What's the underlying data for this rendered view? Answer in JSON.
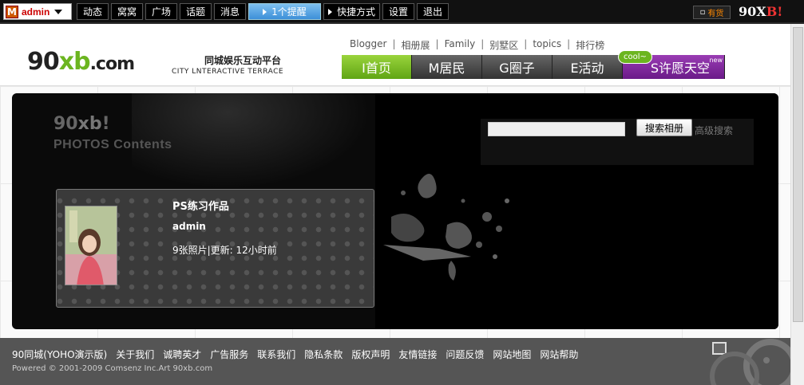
{
  "topbar": {
    "user_initial": "M",
    "username": "admin",
    "nav": [
      "动态",
      "窝窝",
      "广场",
      "话题",
      "消息"
    ],
    "notice": "1个提醒",
    "shortcut": "快捷方式",
    "settings": "设置",
    "logout": "退出",
    "cart_label": "有货",
    "brand_a": "90X",
    "brand_b": "B",
    "brand_c": "!"
  },
  "header": {
    "logo_a": "90",
    "logo_b": "xb",
    "logo_c": ".com",
    "slogan": "同城娱乐互动平台",
    "slogan_en": "CITY LNTERACTIVE TERRACE",
    "links": [
      "Blogger",
      "相册展",
      "Family",
      "别墅区",
      "topics",
      "排行榜"
    ],
    "nav": [
      {
        "label": "I首页"
      },
      {
        "label": "M居民"
      },
      {
        "label": "G圈子"
      },
      {
        "label": "E活动"
      },
      {
        "label": "S许愿天空"
      }
    ],
    "cool_badge": "cool~",
    "new_tag": "new"
  },
  "panel": {
    "logo_a": "90",
    "logo_b": "xb",
    "logo_c": "!",
    "subtitle": "PHOTOS Contents",
    "search_value": "",
    "search_button": "搜索相册",
    "advanced_search": "高级搜索"
  },
  "album": {
    "title": "PS练习作品",
    "author": "admin",
    "meta": "9张照片|更新: 12小时前"
  },
  "footer": {
    "links": [
      "90同城(YOHO演示版)",
      "关于我们",
      "诚聘英才",
      "广告服务",
      "联系我们",
      "隐私条款",
      "版权声明",
      "友情链接",
      "问题反馈",
      "网站地图",
      "网站帮助"
    ],
    "copyright": "Powered © 2001-2009 Comsenz Inc.Art 90xb.com"
  },
  "colors": {
    "accent_green": "#6cb520",
    "active_blue": "#3d8fd8",
    "wish_purple": "#7a2a98"
  }
}
